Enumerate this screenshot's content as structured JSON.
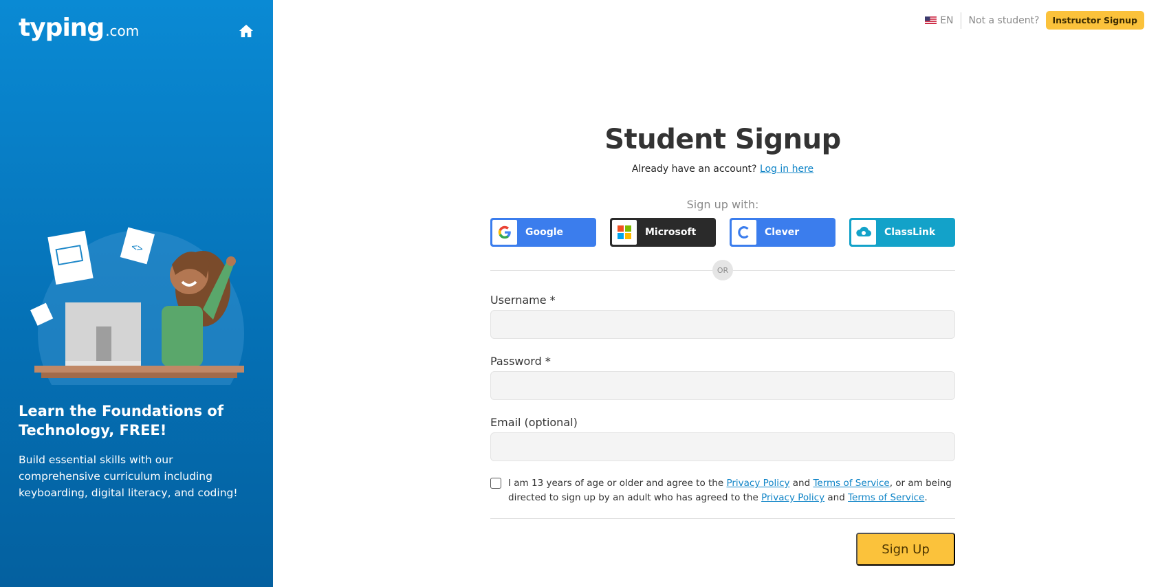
{
  "brand": {
    "logo_main": "typing",
    "logo_suffix": ".com"
  },
  "sidebar": {
    "heading": "Learn the Foundations of Technology, FREE!",
    "body": "Build essential skills with our comprehensive curriculum including keyboarding, digital literacy, and coding!"
  },
  "topbar": {
    "lang": "EN",
    "not_student": "Not a student?",
    "instructor_signup": "Instructor Signup"
  },
  "form": {
    "title": "Student Signup",
    "already_text": "Already have an account?",
    "login_link": "Log in here",
    "signup_with": "Sign up with:",
    "sso": {
      "google": "Google",
      "microsoft": "Microsoft",
      "clever": "Clever",
      "classlink": "ClassLink"
    },
    "or": "OR",
    "username_label": "Username *",
    "username_value": "",
    "password_label": "Password *",
    "password_value": "",
    "email_label": "Email (optional)",
    "email_value": "",
    "consent": {
      "p1": "I am 13 years of age or older and agree to the ",
      "privacy": "Privacy Policy",
      "and": " and ",
      "terms": "Terms of Service",
      "p2": ", or am being directed to sign up by an adult who has agreed to the ",
      "end": "."
    },
    "submit": "Sign Up"
  },
  "colors": {
    "sidebar_blue": "#0a8ad4",
    "accent_yellow": "#fbc23b",
    "google_blue": "#3b7ded",
    "microsoft_dark": "#2a2a2a",
    "classlink_teal": "#13a2c9",
    "link_blue": "#0f84c7"
  },
  "icons": {
    "home": "home-icon",
    "flag": "us-flag-icon",
    "google": "google-icon",
    "microsoft": "microsoft-icon",
    "clever": "clever-icon",
    "classlink": "classlink-icon"
  }
}
